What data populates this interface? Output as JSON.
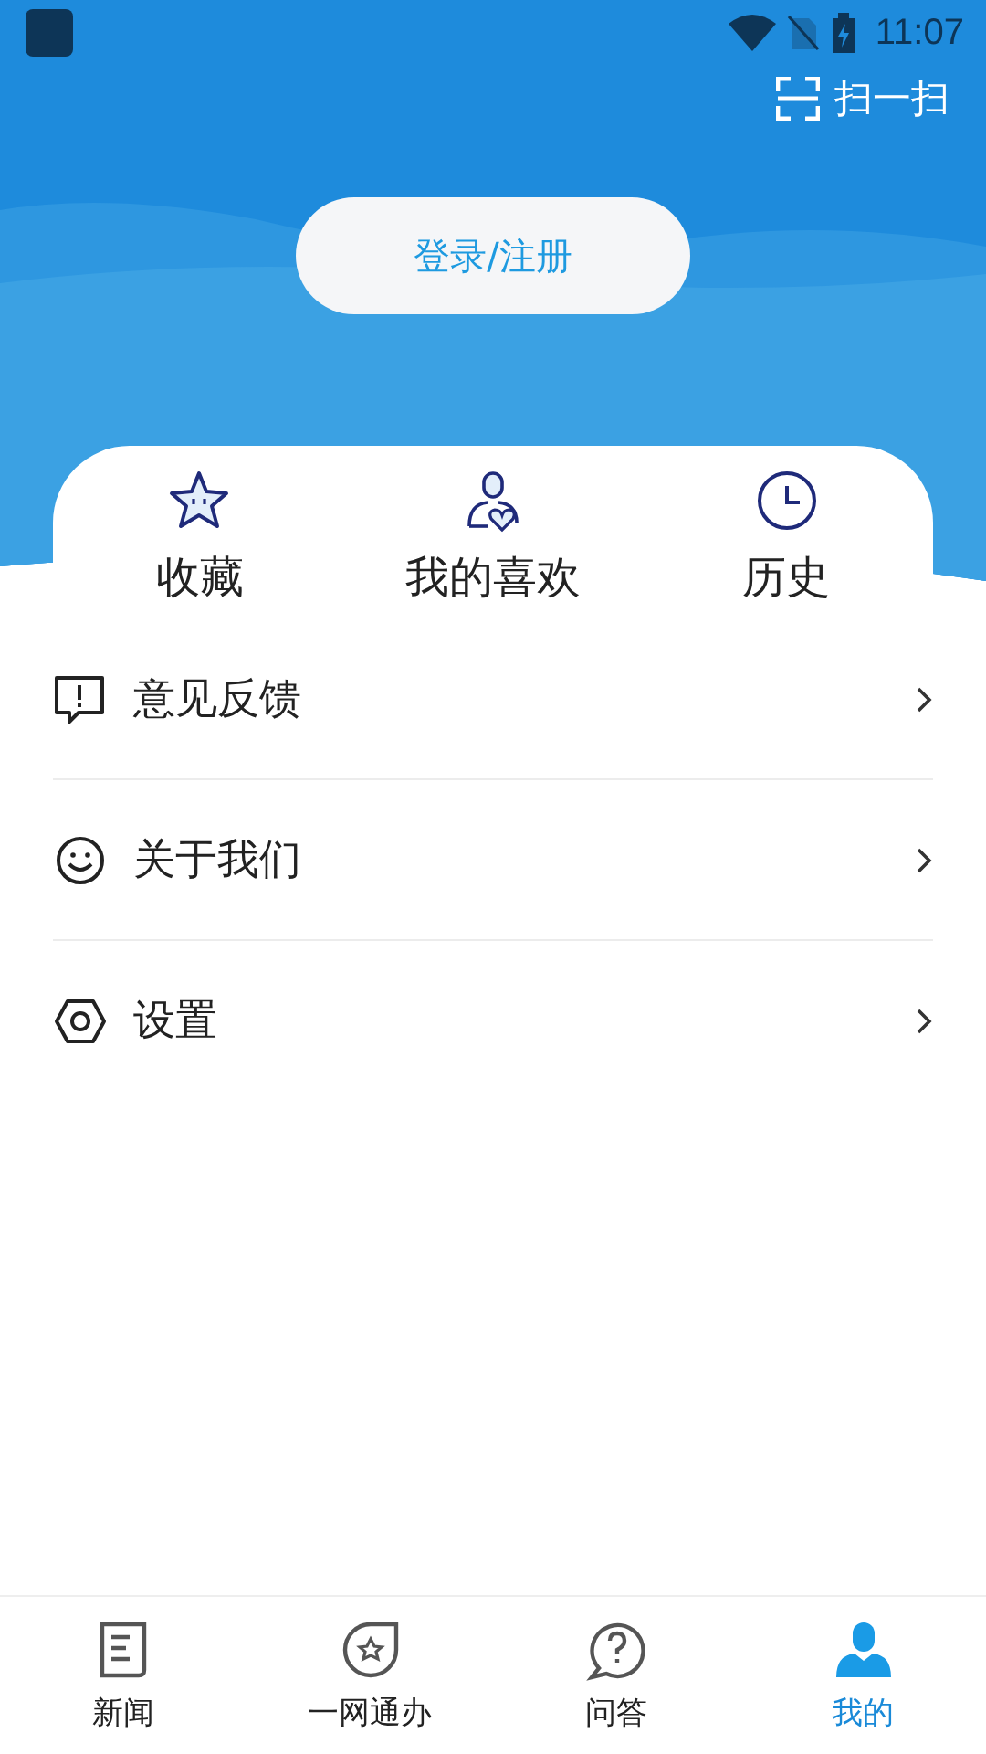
{
  "status_bar": {
    "time": "11:07"
  },
  "scan": {
    "label": "扫一扫"
  },
  "login_button": {
    "label": "登录/注册"
  },
  "quick_links": [
    {
      "kind": "star",
      "label": "收藏"
    },
    {
      "kind": "person-heart",
      "label": "我的喜欢"
    },
    {
      "kind": "clock",
      "label": "历史"
    }
  ],
  "menu": [
    {
      "kind": "feedback",
      "label": "意见反馈"
    },
    {
      "kind": "smile",
      "label": "关于我们"
    },
    {
      "kind": "hexagon",
      "label": "设置"
    }
  ],
  "tab_bar": [
    {
      "kind": "news",
      "label": "新闻",
      "selected": false
    },
    {
      "kind": "service",
      "label": "一网通办",
      "selected": false
    },
    {
      "kind": "qa",
      "label": "问答",
      "selected": false
    },
    {
      "kind": "me",
      "label": "我的",
      "selected": true
    }
  ]
}
